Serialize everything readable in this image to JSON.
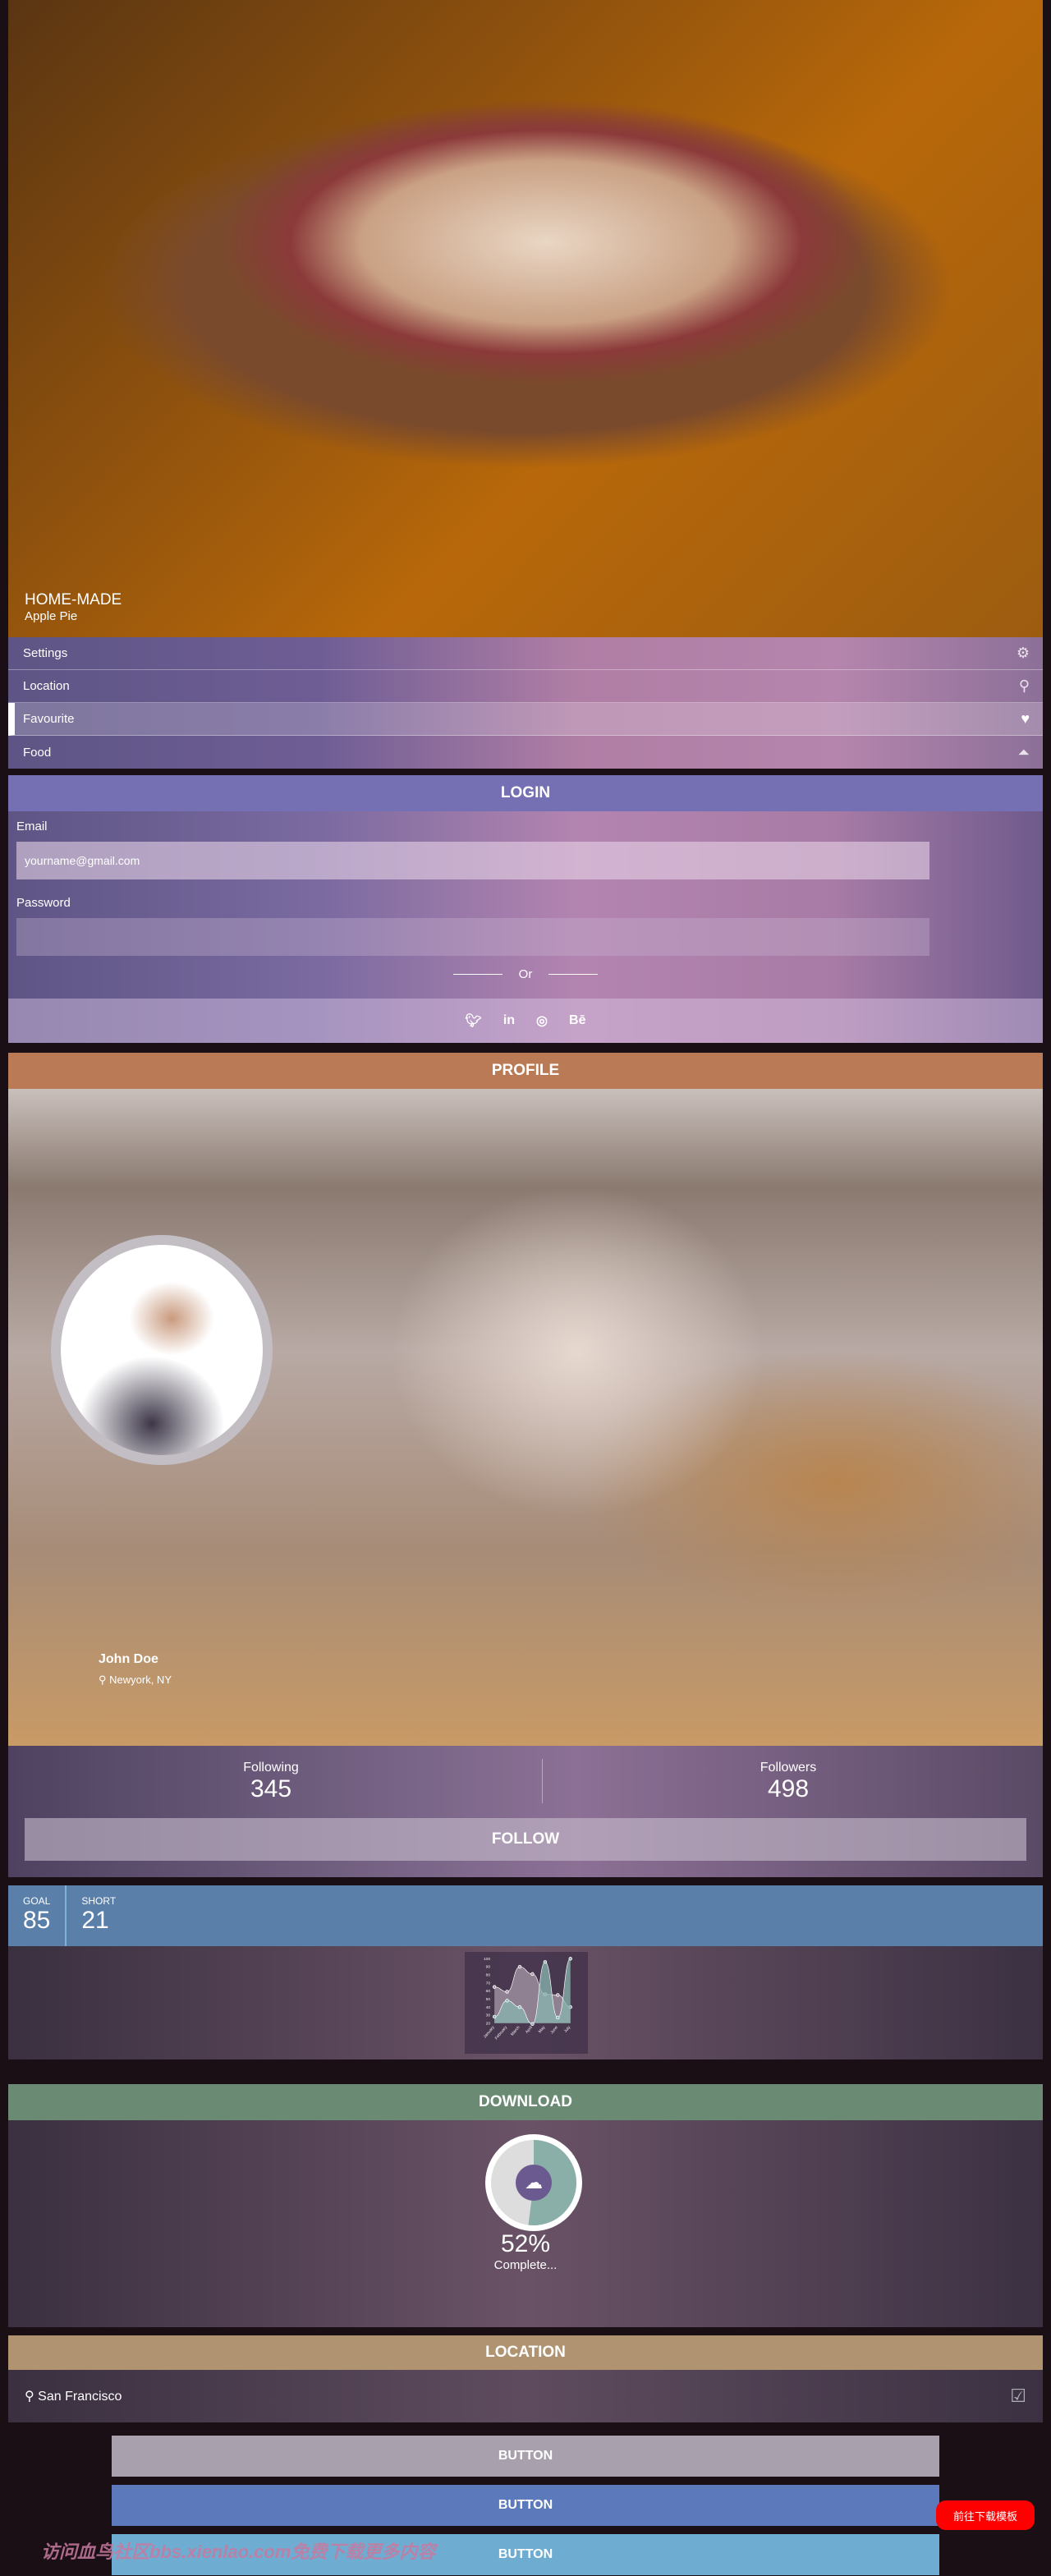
{
  "hero": {
    "title": "HOME-MADE",
    "subtitle": "Apple Pie"
  },
  "menu": [
    {
      "label": "Settings",
      "icon": "gear-icon"
    },
    {
      "label": "Location",
      "icon": "map-pin-icon"
    },
    {
      "label": "Favourite",
      "icon": "heart-icon",
      "active": true
    },
    {
      "label": "Food",
      "icon": "food-cover-icon"
    }
  ],
  "login": {
    "title": "LOGIN",
    "email_label": "Email",
    "email_placeholder": "yourname@gmail.com",
    "password_label": "Password",
    "or": "Or",
    "social": [
      "twitter",
      "linkedin",
      "dribbble",
      "Bē"
    ]
  },
  "profile": {
    "title": "PROFILE",
    "name": "John Doe",
    "location": "Newyork, NY",
    "following_label": "Following",
    "following": "345",
    "followers_label": "Followers",
    "followers": "498",
    "follow_button": "FOLLOW"
  },
  "goals": {
    "goal_label": "GOAL",
    "goal": "85",
    "short_label": "SHORT",
    "short": "21"
  },
  "chart_data": {
    "type": "area",
    "categories": [
      "January",
      "February",
      "March",
      "April",
      "May",
      "June",
      "July"
    ],
    "series": [
      {
        "values": [
          65,
          59,
          90,
          81,
          56,
          55,
          40
        ],
        "color": "#a899a8"
      },
      {
        "values": [
          28,
          48,
          40,
          19,
          96,
          27,
          100
        ],
        "color": "#8ab5b0"
      }
    ],
    "ylim": [
      20,
      100
    ],
    "yticks": [
      20,
      30,
      40,
      50,
      60,
      70,
      80,
      90,
      100
    ]
  },
  "download": {
    "title": "DOWNLOAD",
    "percent": 52,
    "percent_label": "52%",
    "status": "Complete..."
  },
  "location": {
    "title": "LOCATION",
    "city": "San Francisco"
  },
  "buttons": [
    {
      "label": "BUTTON",
      "color": "#a9a0ad"
    },
    {
      "label": "BUTTON",
      "color": "#5b79bb"
    },
    {
      "label": "BUTTON",
      "color": "#6eadd1"
    }
  ],
  "cta": "前往下载模板",
  "watermark": "访问血鸟社区bbs.xienlao.com免费下载更多内容"
}
